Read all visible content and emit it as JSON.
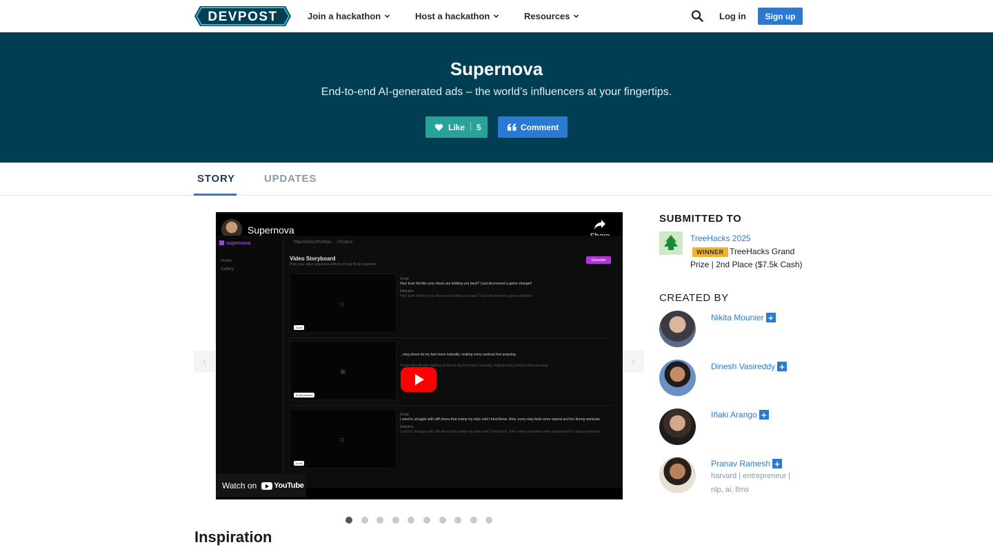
{
  "nav": {
    "logo_text": "DEVPOST",
    "join": "Join a hackathon",
    "host": "Host a hackathon",
    "resources": "Resources",
    "login": "Log in",
    "signup": "Sign up"
  },
  "hero": {
    "title": "Supernova",
    "tagline": "End-to-end AI-generated ads – the world’s influencers at your fingertips.",
    "like_label": "Like",
    "like_count": "5",
    "comment_label": "Comment"
  },
  "tabs": [
    "STORY",
    "UPDATES"
  ],
  "video": {
    "title": "Supernova",
    "share": "Share",
    "watch_on": "Watch on",
    "youtube": "YouTube",
    "app": {
      "logo": "supernova",
      "breadcrumb": "https%3e%2f%2fww...  ›  Product",
      "nav_home": "Home",
      "nav_gallery": "Gallery",
      "storyboard_title": "Video Storyboard",
      "storyboard_sub": "Plan your video sequence with A-roll and B-roll segments",
      "generate": "Generate",
      "rows": [
        {
          "tag": "A-roll",
          "script": "Hey! Ever felt like your shoes are holding you back? I just discovered a game changer!",
          "direction": "Hey! Ever felt like your shoes are holding you back? I just discovered a game changer!"
        },
        {
          "tag": "B-roll product",
          "script": "...ning shoes let my feet move naturally, making every workout feel amazing.",
          "direction": "These ultra-flexible training shoes let my feet move naturally, making every workout feel amazing."
        },
        {
          "tag": "A-roll",
          "script": "I used to struggle with stiff shoes that cramp my style until I tried these. Now, every step feels more natural and fun during workouts.",
          "direction": "I used to struggle with stiff shoes that cramp my style until I tried these. Now, every step feels more natural and fun during workouts."
        }
      ],
      "script_label": "Script",
      "direction_label": "Direction"
    }
  },
  "gallery": {
    "dot_count": 10,
    "active_index": 0
  },
  "story": {
    "heading": "Inspiration"
  },
  "sidebar": {
    "submitted_to": "SUBMITTED TO",
    "hackathon": "TreeHacks 2025",
    "winner_badge": "WINNER",
    "prize_line1": "TreeHacks Grand",
    "prize_line2": "Prize | 2nd Place ($7.5k Cash)",
    "created_by": "CREATED BY",
    "creators": [
      {
        "name": "Nikita Mounier",
        "bio": ""
      },
      {
        "name": "Dinesh Vasireddy",
        "bio": ""
      },
      {
        "name": "Iñaki Arango",
        "bio": ""
      },
      {
        "name": "Pranav Ramesh",
        "bio": "harvard | entrepreneur | nlp, ai, llms"
      }
    ]
  },
  "colors": {
    "hero_bg": "#003e54",
    "like_green": "#28a39a",
    "primary_blue": "#2a7ad3",
    "winner_gold": "#f0b429",
    "youtube_red": "#ff0000"
  }
}
